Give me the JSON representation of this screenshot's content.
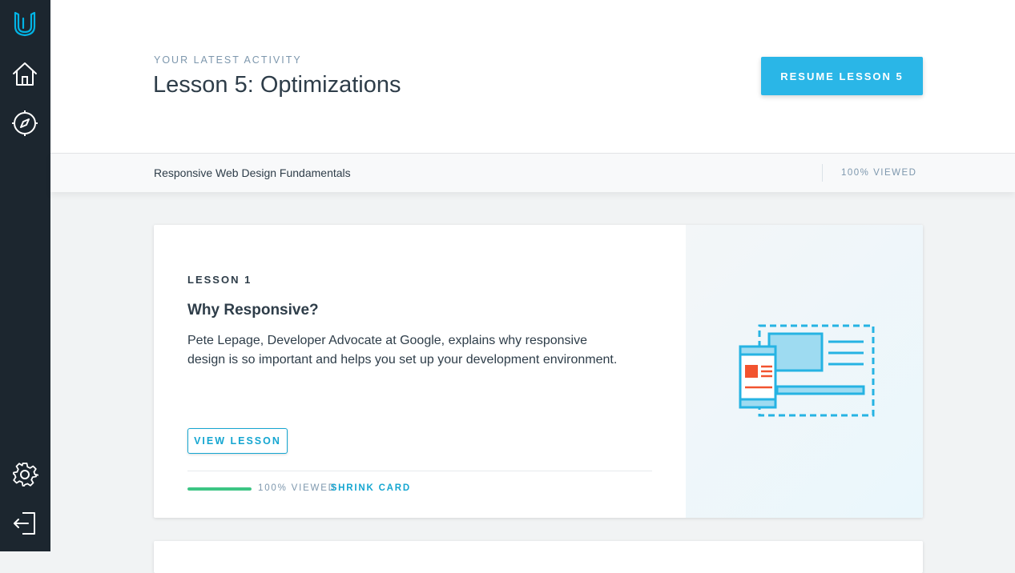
{
  "sidebar": {
    "items": [
      {
        "icon": "udacity-logo-icon"
      },
      {
        "icon": "home-icon"
      },
      {
        "icon": "compass-icon"
      },
      {
        "icon": "gear-icon"
      },
      {
        "icon": "logout-icon"
      }
    ]
  },
  "header": {
    "eyebrow": "YOUR LATEST ACTIVITY",
    "title": "Lesson 5: Optimizations",
    "resume_label": "RESUME LESSON 5"
  },
  "subbar": {
    "course_name": "Responsive Web Design Fundamentals",
    "progress_label": "100% VIEWED"
  },
  "lesson_card": {
    "lesson_number": "LESSON 1",
    "title": "Why Responsive?",
    "description": "Pete Lepage, Developer Advocate at Google, explains why responsive design is so important and helps you set up your development environment.",
    "view_label": "VIEW LESSON",
    "progress_value": 1.0,
    "progress_label": "100% VIEWED",
    "shrink_label": "SHRINK CARD",
    "illustration_icon": "responsive-devices-icon"
  },
  "colors": {
    "sidebar": "#1c262f",
    "accent": "#2ab6e7",
    "link": "#15a6d1",
    "progress": "#3cc584"
  }
}
